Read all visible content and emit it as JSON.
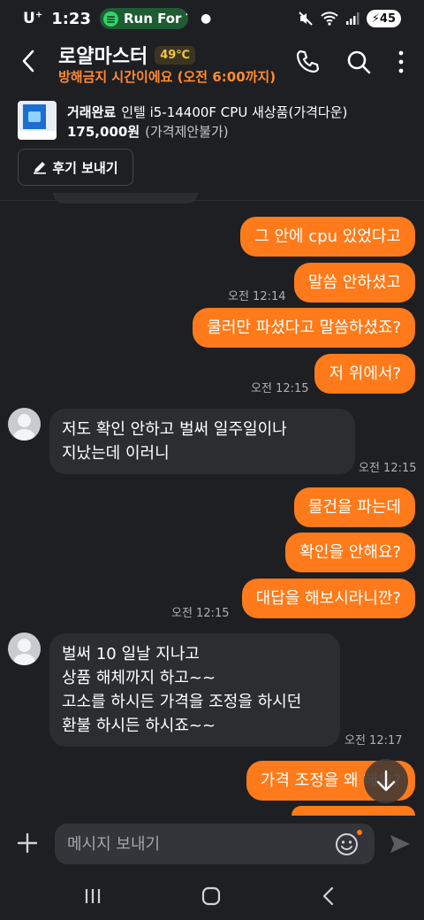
{
  "status_bar": {
    "carrier": "U",
    "carrier_sup": "+",
    "time": "1:23",
    "media_app": "Run For T",
    "battery": "45"
  },
  "header": {
    "seller_name": "로얄마스터",
    "temperature": "49℃",
    "subtitle": "방해금지 시간이에요 (오전 6:00까지)"
  },
  "product": {
    "status": "거래완료",
    "title": "인텔 i5-14400F CPU 새상품(가격다운)",
    "price": "175,000원",
    "price_note": "(가격제안불가)",
    "review_button": "후기 보내기"
  },
  "messages": [
    {
      "side": "out",
      "text": "그 안에 cpu 있었다고"
    },
    {
      "side": "out",
      "text": "말씀 안하셨고",
      "time": "오전 12:14"
    },
    {
      "side": "out",
      "text": "쿨러만 파셨다고 말씀하셨죠?"
    },
    {
      "side": "out",
      "text": "저 위에서?",
      "time": "오전 12:15"
    },
    {
      "side": "in",
      "lines": [
        "저도 확인 안하고 벌써 일주일이나",
        "지났는데 이러니"
      ],
      "time": "오전 12:15"
    },
    {
      "side": "out",
      "text": "물건을 파는데"
    },
    {
      "side": "out",
      "text": "확인을 안해요?"
    },
    {
      "side": "out",
      "text": "대답을 해보시라니깐?",
      "time": "오전 12:15"
    },
    {
      "side": "in",
      "lines": [
        "벌써 10 일날 지나고",
        "상품 해체까지 하고~~",
        "고소를 하시든 가격을 조정을 하시던",
        "환불 하시든 하시죠~~"
      ],
      "time": "오전 12:17"
    },
    {
      "side": "out",
      "text": "가격 조정을 왜 해요?"
    }
  ],
  "input": {
    "placeholder": "메시지 보내기"
  },
  "colors": {
    "accent": "#ff7a1a",
    "background": "#1e1f23",
    "incoming_bubble": "#2c2d31",
    "temperature": "#f2c24b"
  },
  "icons": [
    "back-icon",
    "phone-icon",
    "search-icon",
    "more-icon",
    "pencil-icon",
    "arrow-down-icon",
    "plus-icon",
    "emoji-icon",
    "send-icon",
    "recents-icon",
    "home-icon",
    "nav-back-icon"
  ]
}
